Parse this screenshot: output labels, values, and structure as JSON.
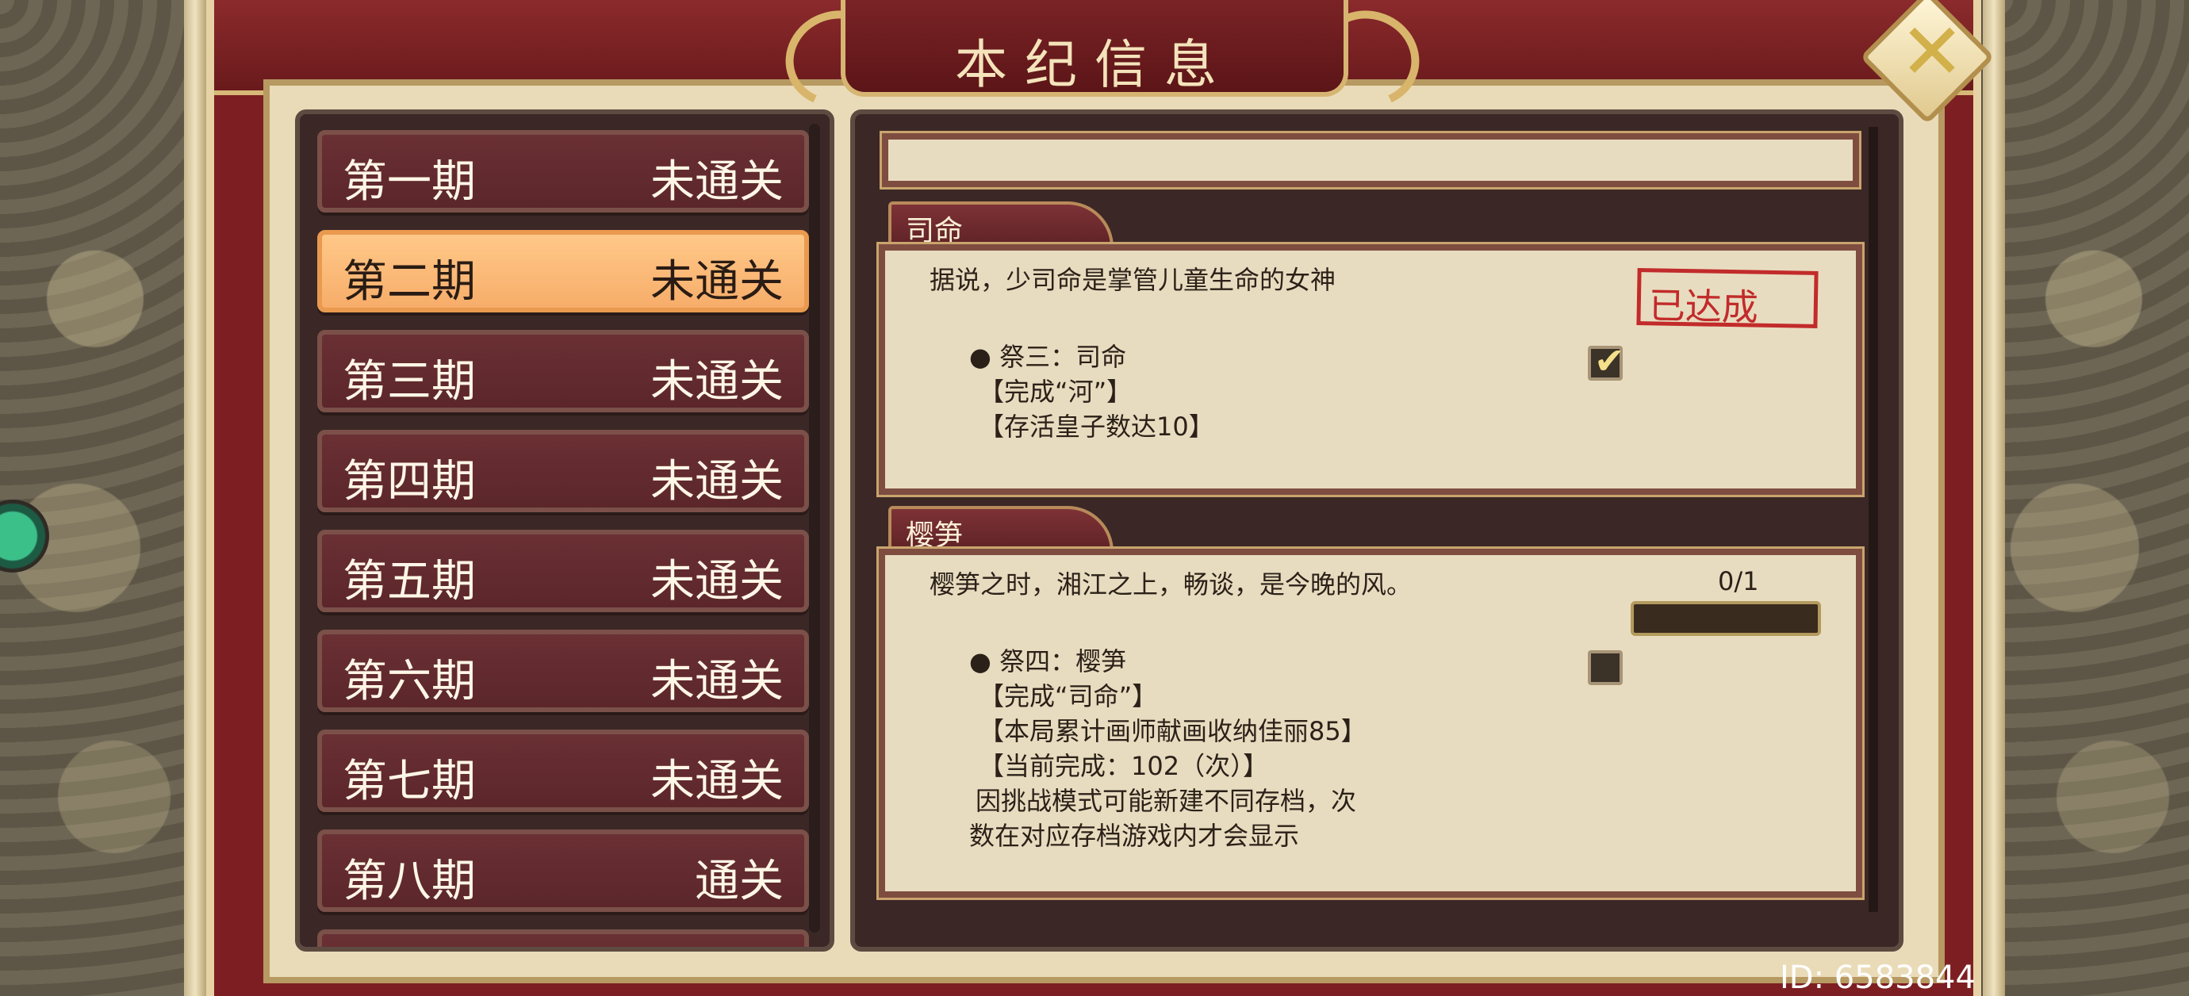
{
  "window": {
    "title": "本纪信息",
    "close_icon": "close-x-icon"
  },
  "periods": [
    {
      "name": "第一期",
      "status": "未通关"
    },
    {
      "name": "第二期",
      "status": "未通关",
      "selected": true
    },
    {
      "name": "第三期",
      "status": "未通关"
    },
    {
      "name": "第四期",
      "status": "未通关"
    },
    {
      "name": "第五期",
      "status": "未通关"
    },
    {
      "name": "第六期",
      "status": "未通关"
    },
    {
      "name": "第七期",
      "status": "未通关"
    },
    {
      "name": "第八期",
      "status": "通关"
    }
  ],
  "sections": [
    {
      "title": "司命",
      "description": "据说，少司命是掌管儿童生命的女神",
      "stamp": "已达成",
      "requirement_lines": [
        "● 祭三：司命",
        "【完成“河”】",
        "【存活皇子数达10】"
      ],
      "checked": true
    },
    {
      "title": "樱笋",
      "description": "樱笋之时，湘江之上，畅谈，是今晚的风。",
      "progress_text": "0/1",
      "progress_fraction": 0,
      "requirement_lines": [
        "● 祭四：樱笋",
        "【完成“司命”】",
        "【本局累计画师献画收纳佳丽85】",
        "【当前完成：102（次）】",
        "因挑战模式可能新建不同存档，次",
        "数在对应存档游戏内才会显示"
      ],
      "checked": false
    }
  ],
  "footer": {
    "user_id": "ID: 6583844"
  },
  "colors": {
    "frame_red": "#7d1f22",
    "selected_orange": "#f7ad6a",
    "stamp_red": "#c22b2b"
  }
}
